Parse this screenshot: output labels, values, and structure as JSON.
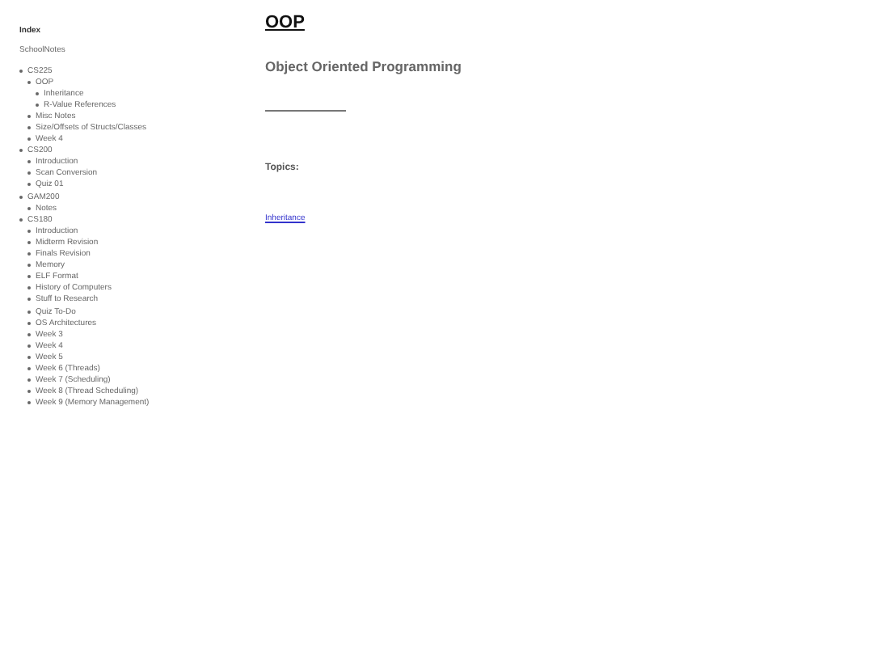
{
  "sidebar": {
    "title": "Index",
    "subtitle": "SchoolNotes",
    "tree": [
      {
        "label": "CS225",
        "children": [
          {
            "label": "OOP",
            "children": [
              {
                "label": "Inheritance"
              },
              {
                "label": "R-Value References"
              }
            ]
          },
          {
            "label": "Misc Notes"
          },
          {
            "label": "Size/Offsets of Structs/Classes"
          },
          {
            "label": "Week 4"
          }
        ]
      },
      {
        "label": "CS200",
        "children": [
          {
            "label": "Introduction"
          },
          {
            "label": "Scan Conversion"
          },
          {
            "label": "Quiz 01"
          }
        ]
      },
      {
        "label": "GAM200",
        "children": [
          {
            "label": "Notes"
          }
        ]
      },
      {
        "label": "CS180",
        "children": [
          {
            "label": "Introduction"
          },
          {
            "label": "Midterm Revision"
          },
          {
            "label": "Finals Revision"
          },
          {
            "label": "Memory"
          },
          {
            "label": "ELF Format"
          },
          {
            "label": "History of Computers"
          },
          {
            "label": "Stuff to Research"
          },
          {
            "label": "Quiz To-Do"
          },
          {
            "label": "OS Architectures"
          },
          {
            "label": "Week 3"
          },
          {
            "label": "Week 4"
          },
          {
            "label": "Week 5"
          },
          {
            "label": "Week 6 (Threads)"
          },
          {
            "label": "Week 7 (Scheduling)"
          },
          {
            "label": "Week 8 (Thread Scheduling)"
          },
          {
            "label": "Week 9 (Memory Management)"
          }
        ]
      }
    ]
  },
  "page": {
    "title": "OOP",
    "subtitle": "Object Oriented Programming",
    "topics_heading": "Topics:",
    "topics": [
      "Inheritance"
    ]
  }
}
